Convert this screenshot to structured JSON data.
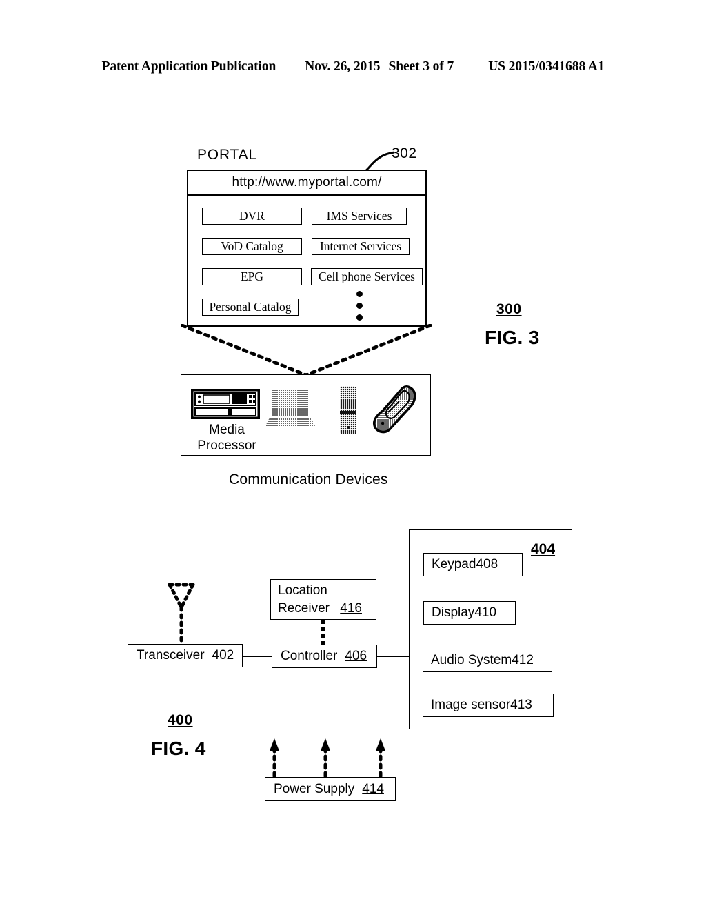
{
  "header": {
    "publication": "Patent Application Publication",
    "date": "Nov. 26, 2015",
    "sheet": "Sheet 3 of 7",
    "pub_number": "US 2015/0341688 A1"
  },
  "figure3": {
    "ref": "300",
    "fig_label": "FIG. 3",
    "portal": {
      "title": "PORTAL",
      "callout_ref": "302",
      "url": "http://www.myportal.com/",
      "left_buttons": [
        "DVR",
        "VoD Catalog",
        "EPG",
        "Personal Catalog"
      ],
      "right_buttons": [
        "IMS Services",
        "Internet Services",
        "Cell phone Services"
      ],
      "ellipsis_dots": 3
    },
    "devices": {
      "caption": "Communication Devices",
      "items": [
        {
          "icon": "media-processor-icon",
          "label_line1": "Media",
          "label_line2": "Processor"
        },
        {
          "icon": "laptop-icon",
          "label_line1": "",
          "label_line2": ""
        },
        {
          "icon": "cell-phone-icon",
          "label_line1": "",
          "label_line2": ""
        },
        {
          "icon": "flip-phone-icon",
          "label_line1": "",
          "label_line2": ""
        }
      ]
    }
  },
  "figure4": {
    "ref": "400",
    "fig_label": "FIG. 4",
    "device_ref": "404",
    "blocks": {
      "transceiver": {
        "name": "Transceiver",
        "ref": "402"
      },
      "controller": {
        "name": "Controller",
        "ref": "406"
      },
      "location_receiver": {
        "name_line1": "Location",
        "name_line2": "Receiver",
        "ref": "416"
      },
      "keypad": {
        "name": "Keypad",
        "ref": "408"
      },
      "display": {
        "name": "Display",
        "ref": "410"
      },
      "audio_system": {
        "name": "Audio System",
        "ref": "412"
      },
      "image_sensor": {
        "name": "Image sensor",
        "ref": "413"
      },
      "power_supply": {
        "name": "Power Supply",
        "ref": "414"
      }
    }
  },
  "colors": {
    "ink": "#000000",
    "paper": "#ffffff",
    "icon_gray": "#9a9a9a"
  }
}
